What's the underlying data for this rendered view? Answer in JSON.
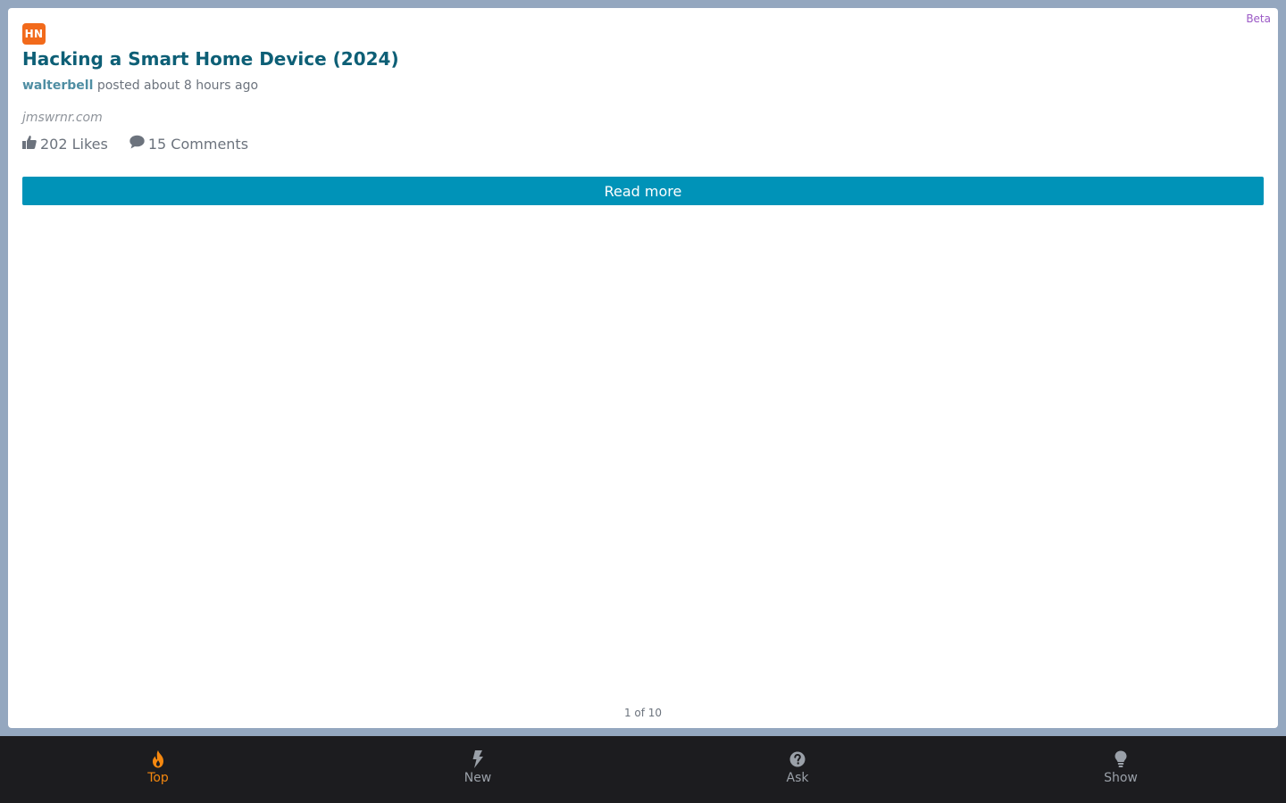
{
  "beta_label": "Beta",
  "story": {
    "source_badge": "HN",
    "title": "Hacking a Smart Home Device (2024)",
    "author": "walterbell",
    "posted_text": "posted about 8 hours ago",
    "domain": "jmswrnr.com",
    "likes_text": "202 Likes",
    "comments_text": "15 Comments",
    "read_more_label": "Read more"
  },
  "pagination": {
    "text": "1 of 10"
  },
  "colors": {
    "badge": "#f26a1b",
    "title": "#0d5f76",
    "button": "#0093b8",
    "active_tab": "#f5880f",
    "tab_bar": "#1c1c1f",
    "frame": "#94a7bf"
  },
  "tabs": [
    {
      "label": "Top",
      "icon": "flame-icon",
      "active": true
    },
    {
      "label": "New",
      "icon": "bolt-icon",
      "active": false
    },
    {
      "label": "Ask",
      "icon": "question-circle-icon",
      "active": false
    },
    {
      "label": "Show",
      "icon": "lightbulb-icon",
      "active": false
    }
  ]
}
